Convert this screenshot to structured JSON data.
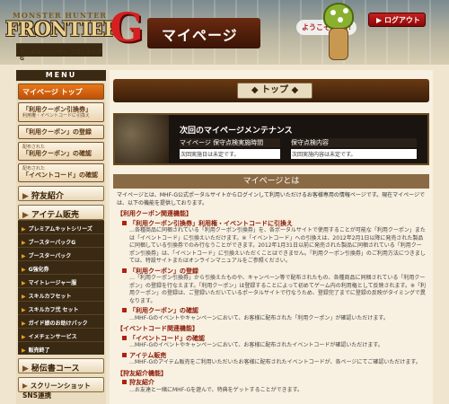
{
  "header": {
    "logo_top": "MONSTER HUNTER",
    "logo_main": "FRONTIER",
    "logo_g": "G",
    "logo_sub": "モンスターハンター フロンティアG",
    "page_title": "マイページ",
    "welcome": "ようこそ・ニ!!",
    "logout_label": "ログアウト"
  },
  "sidebar": {
    "menu_label": "MENU",
    "top_label": "マイページ トップ",
    "coupon_exchange": {
      "title": "「利用クーポン引換券」",
      "small": "利用権・イベントコードに引換え"
    },
    "coupon_register": "「利用クーポン」の登録",
    "coupon_check": {
      "pre": "配布された",
      "title": "「利用クーポン」の確認"
    },
    "event_check": {
      "pre": "配布された",
      "title": "「イベントコード」の確認"
    },
    "friend": "狩友紹介",
    "item_sale": "アイテム販売",
    "sub_items": [
      "プレミアムキットシリーズ",
      "ブースターパックG",
      "ブースターパック",
      "G強化券",
      "マイトレージャー服",
      "スキルカフセット",
      "スキルカフ弐 セット",
      "ガイド娘のお助けパック",
      "イメチェンサービス",
      "販売終了"
    ],
    "secret": "秘伝書コース",
    "sns": "スクリーンショットSNS連携"
  },
  "content": {
    "title": "トップ",
    "maintenance": {
      "title": "次回のマイページメンテナンス",
      "col1_head": "マイページ 保守点検実施時間",
      "col2_head": "保守点検内容",
      "col1_val": "次回実施日は未定です。",
      "col2_val": "次回実施内容は未定です。"
    },
    "about_title": "マイページとは",
    "about_intro": "マイページとは、MHF-G公式ポータルサイトからログインして利用いただけるお客様専用の情報ページです。現在マイページでは、以下の機能を提供しております。",
    "sections": [
      {
        "name": "【利用クーポン関連機能】",
        "items": [
          {
            "title": "「利用クーポン引換券」利用権・イベントコードに引換え",
            "desc": "…各種商品に同梱されている「利用クーポン引換券」を、各ポータルサイトで使用することが可能な「利用クーポン」または「イベントコード」に引換えいただけます。※「イベントコード」への引換えは、2012年2月1日以降に発売された製品に同梱している引換券でのみ行なうことができます。2012年1月31日以前に発売された製品に同梱されている「利用クーポン引換券」は、「イベントコード」に引換えいただくことはできません。「利用クーポン引換券」のご利用方法につきましては、特設サイトまたはオンラインマニュアルをご参照ください。"
          },
          {
            "title": "「利用クーポン」の登録",
            "desc": "…「利用クーポン引換券」から引換えたものや、キャンペーン等で配布されたもの、各種商品に同梱されている「利用クーポン」の登録を行なえます。「利用クーポン」は登録することによって初めてゲーム内の利用権として反映されます。※「利用クーポン」の登録は、ご登録いただいているポータルサイトで行なうため、登録完了までに登録の反映がタイミングで異なります。"
          },
          {
            "title": "「利用クーポン」の確認",
            "desc": "…MHF-Gのイベントやキャンペーンにおいて、お客様に配布された「利用クーポン」が確認いただけます。"
          }
        ]
      },
      {
        "name": "【イベントコード関連機能】",
        "items": [
          {
            "title": "「イベントコード」の確認",
            "desc": "…MHF-Gのイベントやキャンペーンにおいて、お客様に配布されたイベントコードが確認いただけます。"
          },
          {
            "title": "アイテム販売",
            "desc": "…MHF-Gのアイテム販売をご利用いただいたお客様に配布されたイベントコードが、各ページにてご確認いただけます。"
          }
        ]
      },
      {
        "name": "【狩友紹介機能】",
        "items": [
          {
            "title": "狩友紹介",
            "desc": "…お友達と一緒にMHF-Gを遊んで、特典をゲットすることができます。"
          }
        ]
      }
    ]
  }
}
